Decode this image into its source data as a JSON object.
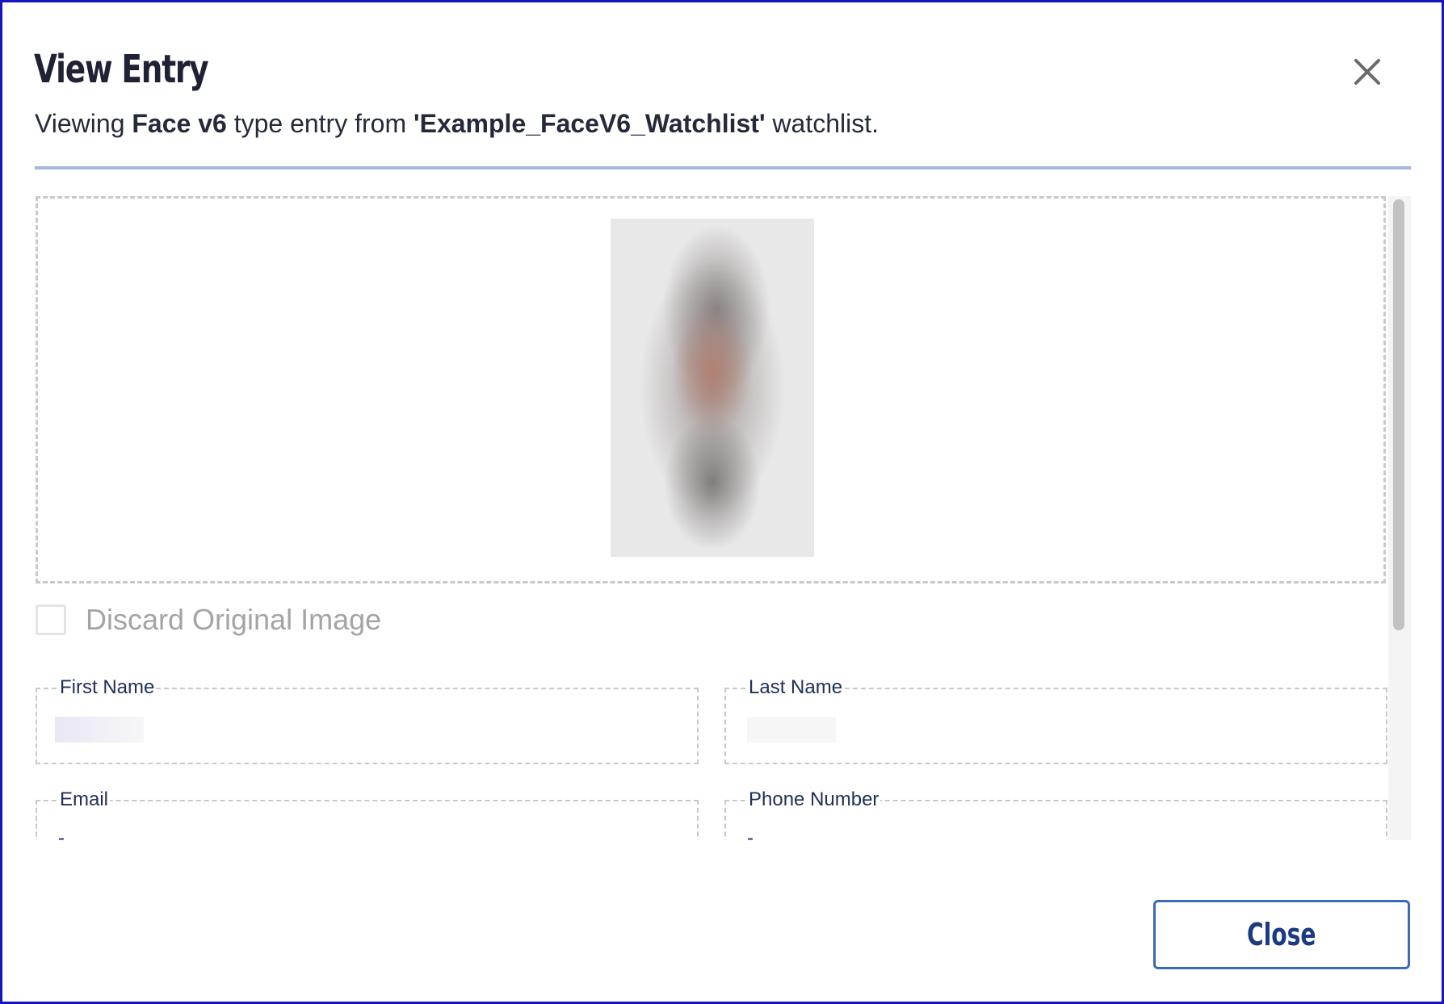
{
  "dialog": {
    "title": "View Entry",
    "subtitle": {
      "prefix": "Viewing ",
      "type": "Face v6",
      "middle": " type entry from ",
      "watchlist": "'Example_FaceV6_Watchlist'",
      "suffix": " watchlist."
    },
    "close_icon": "close-icon"
  },
  "image_section": {
    "discard_label": "Discard Original Image",
    "discard_checked": false
  },
  "fields": {
    "first_name": {
      "label": "First Name",
      "value": ""
    },
    "last_name": {
      "label": "Last Name",
      "value": ""
    },
    "email": {
      "label": "Email",
      "value": "-"
    },
    "phone": {
      "label": "Phone Number",
      "value": "-"
    }
  },
  "footer": {
    "close_label": "Close"
  },
  "colors": {
    "frame_border": "#1515c0",
    "title": "#1f2235",
    "divider": "#a4b7dc",
    "field_label": "#20305a",
    "button_border": "#3a6ab8",
    "button_text": "#1b3a84"
  }
}
